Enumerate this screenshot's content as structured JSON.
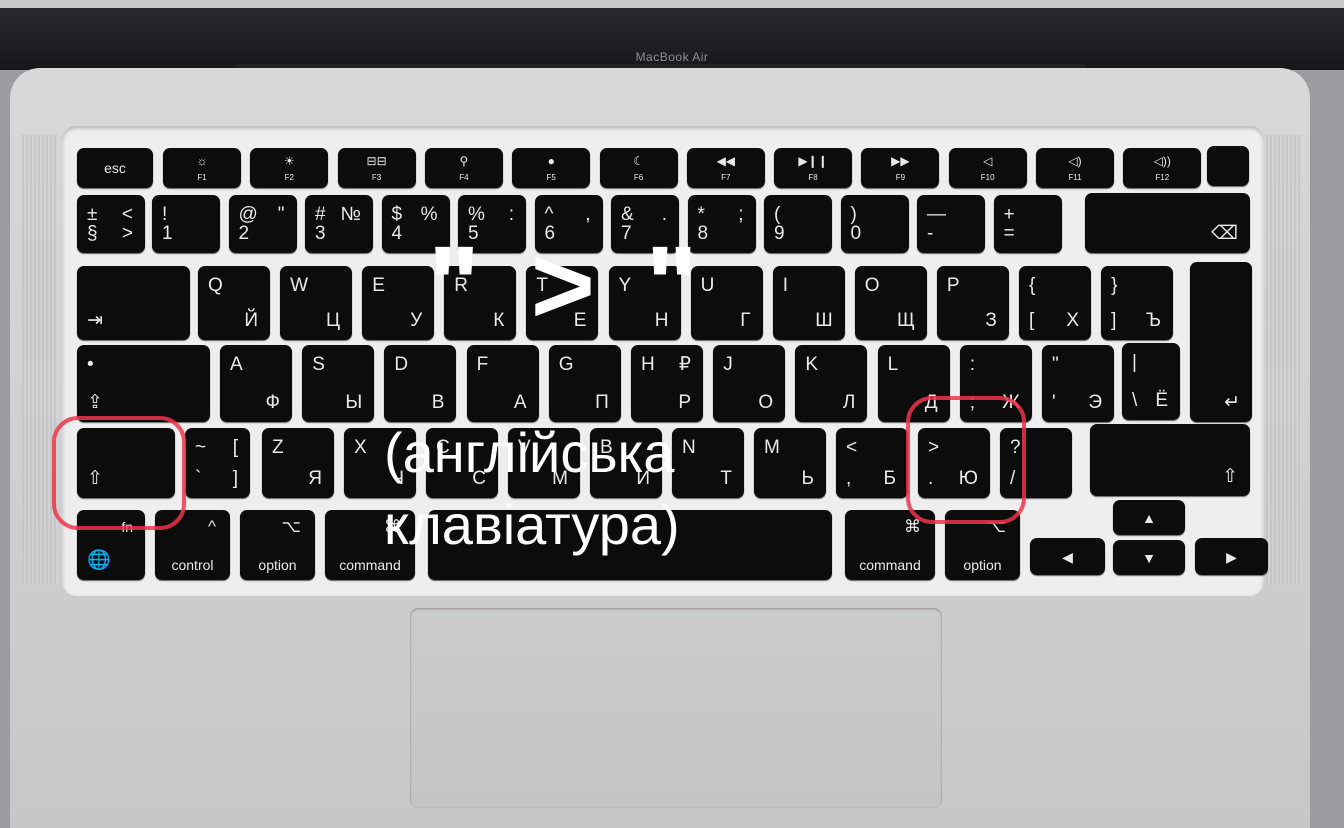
{
  "device_brand": "MacBook Air",
  "annotation": {
    "quote": "\" > \"",
    "caption_line1": "(англійська",
    "caption_line2": "клавіатура)",
    "highlight_color": "#f0344a",
    "highlighted_keys": [
      "left-shift",
      "period-greater-than"
    ]
  },
  "keyboard": {
    "rows": [
      [
        {
          "c": "esc"
        },
        {
          "icon": "☼",
          "sub": "F1"
        },
        {
          "icon": "☀",
          "sub": "F2"
        },
        {
          "icon": "⊟⊟",
          "sub": "F3"
        },
        {
          "icon": "⚲",
          "sub": "F4"
        },
        {
          "icon": "●",
          "sub": "F5"
        },
        {
          "icon": "☾",
          "sub": "F6"
        },
        {
          "icon": "◀◀",
          "sub": "F7"
        },
        {
          "icon": "▶❙❙",
          "sub": "F8"
        },
        {
          "icon": "▶▶",
          "sub": "F9"
        },
        {
          "icon": "◁",
          "sub": "F10"
        },
        {
          "icon": "◁)",
          "sub": "F11"
        },
        {
          "icon": "◁))",
          "sub": "F12"
        },
        {
          "c": ""
        }
      ],
      [
        {
          "tl": "±",
          "tr": "<",
          "bl": "§",
          "br": ">"
        },
        {
          "tl": "!",
          "bl": "1"
        },
        {
          "tl": "@",
          "tr": "\"",
          "bl": "2"
        },
        {
          "tl": "#",
          "tr": "№",
          "bl": "3"
        },
        {
          "tl": "$",
          "tr": "%",
          "bl": "4"
        },
        {
          "tl": "%",
          "tr": ":",
          "bl": "5"
        },
        {
          "tl": "^",
          "tr": ",",
          "bl": "6"
        },
        {
          "tl": "&",
          "tr": ".",
          "bl": "7"
        },
        {
          "tl": "*",
          "tr": ";",
          "bl": "8"
        },
        {
          "tl": "(",
          "bl": "9"
        },
        {
          "tl": ")",
          "bl": "0"
        },
        {
          "tl": "—",
          "bl": "-"
        },
        {
          "tl": "+",
          "bl": "="
        },
        {
          "br": "⌫"
        }
      ],
      [
        {
          "bl": "⇥"
        },
        {
          "tl": "Q",
          "br": "Й"
        },
        {
          "tl": "W",
          "br": "Ц"
        },
        {
          "tl": "E",
          "br": "У"
        },
        {
          "tl": "R",
          "br": "К"
        },
        {
          "tl": "T",
          "br": "Е"
        },
        {
          "tl": "Y",
          "br": "Н"
        },
        {
          "tl": "U",
          "br": "Г"
        },
        {
          "tl": "I",
          "br": "Ш"
        },
        {
          "tl": "O",
          "br": "Щ"
        },
        {
          "tl": "P",
          "br": "З"
        },
        {
          "tl": "{",
          "bl": "[",
          "br": "Х"
        },
        {
          "tl": "}",
          "bl": "]",
          "br": "Ъ"
        },
        {
          "br": "↵"
        }
      ],
      [
        {
          "tl": "•",
          "bl": "⇪"
        },
        {
          "tl": "A",
          "br": "Ф"
        },
        {
          "tl": "S",
          "br": "Ы"
        },
        {
          "tl": "D",
          "br": "В"
        },
        {
          "tl": "F",
          "br": "А"
        },
        {
          "tl": "G",
          "br": "П"
        },
        {
          "tl": "H",
          "tr": "₽",
          "br": "Р"
        },
        {
          "tl": "J",
          "br": "О"
        },
        {
          "tl": "K",
          "br": "Л"
        },
        {
          "tl": "L",
          "br": "Д"
        },
        {
          "tl": ":",
          "bl": ";",
          "br": "Ж"
        },
        {
          "tl": "\"",
          "bl": "'",
          "br": "Э"
        },
        {
          "tl": "|",
          "bl": "\\",
          "br": "Ё"
        }
      ],
      [
        {
          "bl": "⇧"
        },
        {
          "tl": "~",
          "tr": "[",
          "bl": "`",
          "br": "]"
        },
        {
          "tl": "Z",
          "br": "Я"
        },
        {
          "tl": "X",
          "br": "Ч"
        },
        {
          "tl": "C",
          "br": "С"
        },
        {
          "tl": "V",
          "br": "М"
        },
        {
          "tl": "B",
          "br": "И"
        },
        {
          "tl": "N",
          "br": "Т"
        },
        {
          "tl": "M",
          "br": "Ь"
        },
        {
          "tl": "<",
          "bl": ",",
          "br": "Б"
        },
        {
          "tl": ">",
          "bl": ".",
          "br": "Ю"
        },
        {
          "tl": "?",
          "bl": "/"
        },
        {
          "br": "⇧"
        }
      ],
      [
        {
          "tr": "fn",
          "bl": "🌐"
        },
        {
          "mt": "^",
          "mb": "control"
        },
        {
          "mt": "⌥",
          "mb": "option"
        },
        {
          "mt": "⌘",
          "mb": "command"
        },
        {
          "c": ""
        },
        {
          "mt": "⌘",
          "mb": "command"
        },
        {
          "mt": "⌥",
          "mb": "option"
        },
        {
          "c": "◀"
        },
        {
          "c": "▲"
        },
        {
          "c": "▼"
        },
        {
          "c": "▶"
        }
      ]
    ]
  }
}
